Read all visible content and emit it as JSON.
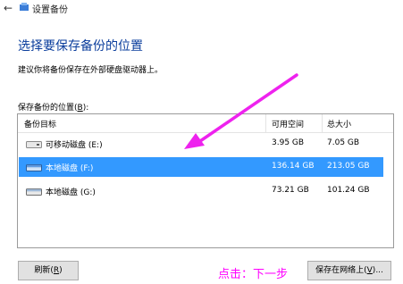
{
  "window": {
    "title": "设置备份"
  },
  "heading": "选择要保存备份的位置",
  "description": "建议你将备份保存在外部硬盘驱动器上。",
  "list": {
    "label_prefix": "保存备份的位置(",
    "label_key": "B",
    "label_suffix": "):",
    "columns": {
      "target": "备份目标",
      "free": "可用空间",
      "total": "总大小"
    },
    "rows": [
      {
        "name": "可移动磁盘 (E:)",
        "free": "3.95 GB",
        "total": "7.05 GB",
        "icon": "removable-drive-icon",
        "selected": false
      },
      {
        "name": "本地磁盘 (F:)",
        "free": "136.14 GB",
        "total": "213.05 GB",
        "icon": "local-disk-icon",
        "selected": true
      },
      {
        "name": "本地磁盘 (G:)",
        "free": "73.21 GB",
        "total": "101.24 GB",
        "icon": "local-disk-icon",
        "selected": false
      }
    ]
  },
  "buttons": {
    "refresh": {
      "text": "刷新",
      "key": "R"
    },
    "save_network": {
      "text": "保存在网络上",
      "key": "V",
      "suffix": "..."
    }
  },
  "annotation": {
    "hint": "点击：下一步",
    "color": "#ff00ff"
  },
  "colors": {
    "selection": "#3399ff",
    "heading": "#0a3d9c"
  }
}
